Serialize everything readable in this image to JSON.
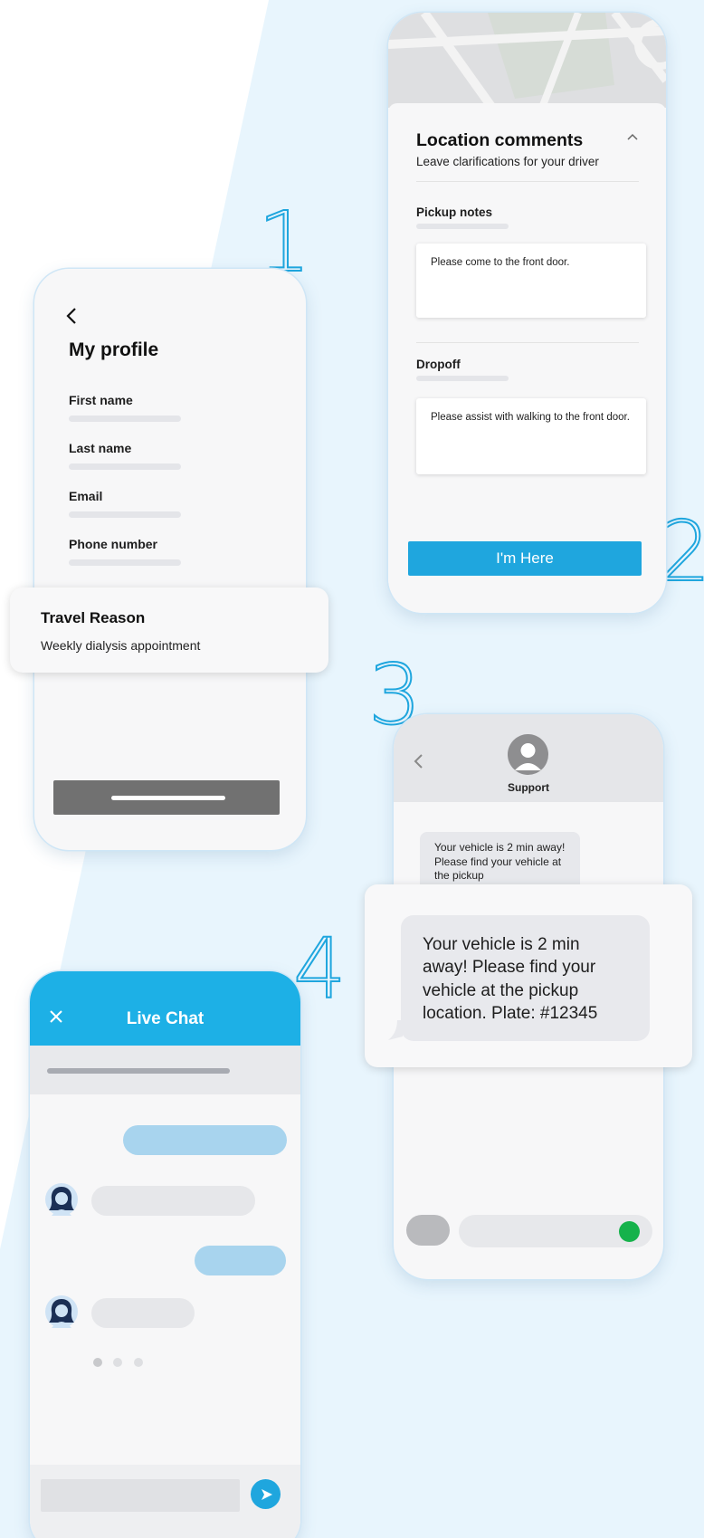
{
  "steps": [
    "1",
    "2",
    "3",
    "4"
  ],
  "profile": {
    "title": "My profile",
    "fields": [
      "First name",
      "Last name",
      "Email",
      "Phone number"
    ],
    "travel_card": {
      "title": "Travel Reason",
      "value": "Weekly dialysis appointment"
    }
  },
  "location": {
    "title": "Location comments",
    "subtitle": "Leave clarifications for your driver",
    "pickup_label": "Pickup notes",
    "pickup_note": "Please come to the front door.",
    "dropoff_label": "Dropoff",
    "dropoff_note": "Please assist with walking to the front door.",
    "button_label": "I'm Here"
  },
  "sms": {
    "contact": "Support",
    "small_message": "Your vehicle is 2 min away! Please find your vehicle at the pickup",
    "big_message": "Your vehicle is 2 min away! Please find your vehicle at the pickup location. Plate: #12345"
  },
  "live_chat": {
    "title": "Live Chat"
  },
  "colors": {
    "accent": "#1fa6de",
    "chat_header": "#1db0e6",
    "bubble_blue": "#a8d4ee",
    "send_green": "#16b24b",
    "background": "#e8f5fd"
  },
  "icons": [
    "back-chevron-icon",
    "collapse-chevron-icon",
    "avatar-icon",
    "close-icon",
    "send-icon"
  ]
}
